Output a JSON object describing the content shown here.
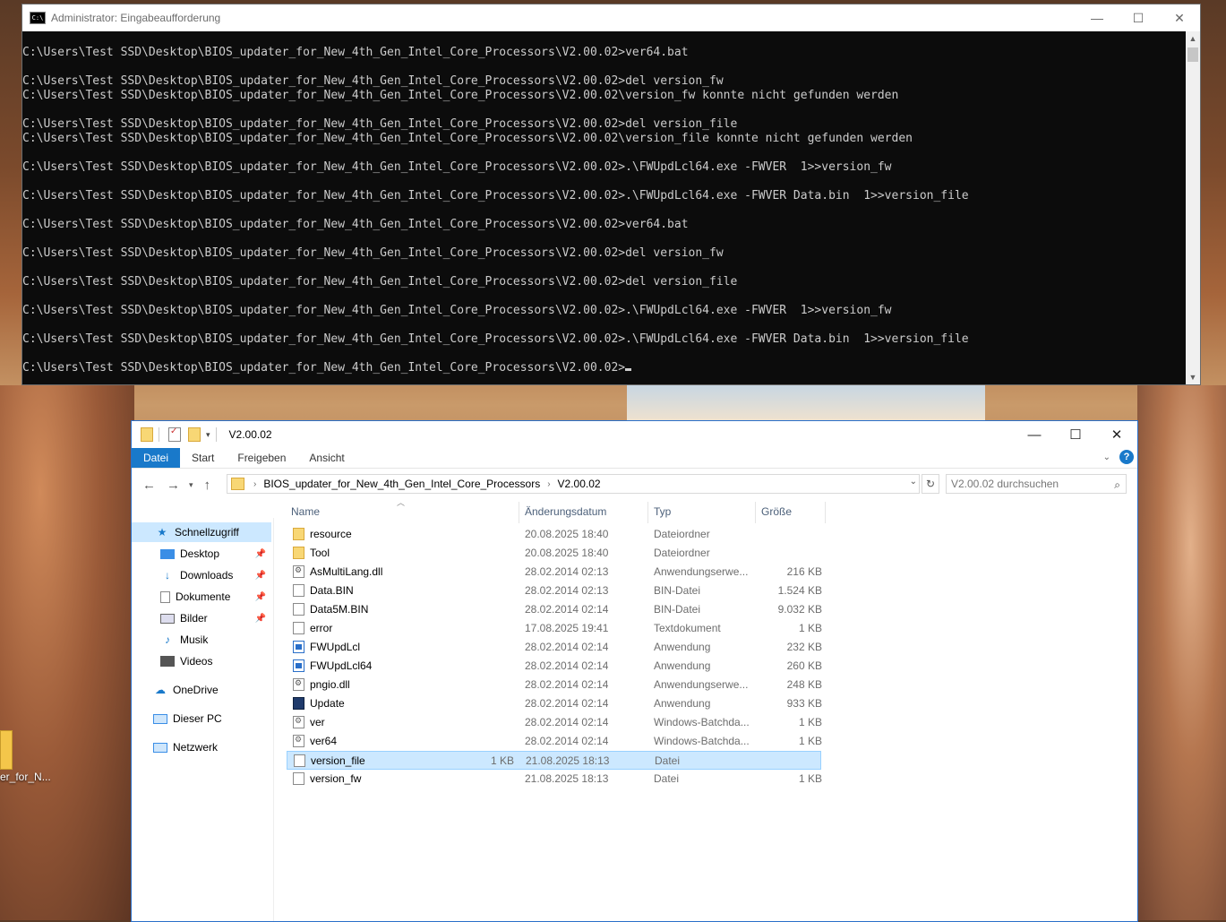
{
  "desktop": {
    "icon_label": "er_for_N..."
  },
  "cmd": {
    "icon": "C:\\",
    "title": "Administrator: Eingabeaufforderung",
    "lines": [
      "",
      "C:\\Users\\Test SSD\\Desktop\\BIOS_updater_for_New_4th_Gen_Intel_Core_Processors\\V2.00.02>ver64.bat",
      "",
      "C:\\Users\\Test SSD\\Desktop\\BIOS_updater_for_New_4th_Gen_Intel_Core_Processors\\V2.00.02>del version_fw",
      "C:\\Users\\Test SSD\\Desktop\\BIOS_updater_for_New_4th_Gen_Intel_Core_Processors\\V2.00.02\\version_fw konnte nicht gefunden werden",
      "",
      "C:\\Users\\Test SSD\\Desktop\\BIOS_updater_for_New_4th_Gen_Intel_Core_Processors\\V2.00.02>del version_file",
      "C:\\Users\\Test SSD\\Desktop\\BIOS_updater_for_New_4th_Gen_Intel_Core_Processors\\V2.00.02\\version_file konnte nicht gefunden werden",
      "",
      "C:\\Users\\Test SSD\\Desktop\\BIOS_updater_for_New_4th_Gen_Intel_Core_Processors\\V2.00.02>.\\FWUpdLcl64.exe -FWVER  1>>version_fw",
      "",
      "C:\\Users\\Test SSD\\Desktop\\BIOS_updater_for_New_4th_Gen_Intel_Core_Processors\\V2.00.02>.\\FWUpdLcl64.exe -FWVER Data.bin  1>>version_file",
      "",
      "C:\\Users\\Test SSD\\Desktop\\BIOS_updater_for_New_4th_Gen_Intel_Core_Processors\\V2.00.02>ver64.bat",
      "",
      "C:\\Users\\Test SSD\\Desktop\\BIOS_updater_for_New_4th_Gen_Intel_Core_Processors\\V2.00.02>del version_fw",
      "",
      "C:\\Users\\Test SSD\\Desktop\\BIOS_updater_for_New_4th_Gen_Intel_Core_Processors\\V2.00.02>del version_file",
      "",
      "C:\\Users\\Test SSD\\Desktop\\BIOS_updater_for_New_4th_Gen_Intel_Core_Processors\\V2.00.02>.\\FWUpdLcl64.exe -FWVER  1>>version_fw",
      "",
      "C:\\Users\\Test SSD\\Desktop\\BIOS_updater_for_New_4th_Gen_Intel_Core_Processors\\V2.00.02>.\\FWUpdLcl64.exe -FWVER Data.bin  1>>version_file",
      "",
      "C:\\Users\\Test SSD\\Desktop\\BIOS_updater_for_New_4th_Gen_Intel_Core_Processors\\V2.00.02>"
    ]
  },
  "explorer": {
    "title": "V2.00.02",
    "ribbon_tabs": [
      "Datei",
      "Start",
      "Freigeben",
      "Ansicht"
    ],
    "help": "?",
    "breadcrumb": [
      "BIOS_updater_for_New_4th_Gen_Intel_Core_Processors",
      "V2.00.02"
    ],
    "search_placeholder": "V2.00.02 durchsuchen",
    "nav": [
      {
        "label": "Schnellzugriff",
        "icon": "star-icon",
        "pinned": false,
        "selected": true
      },
      {
        "label": "Desktop",
        "icon": "desktop-icon",
        "pinned": true
      },
      {
        "label": "Downloads",
        "icon": "download-icon",
        "pinned": true
      },
      {
        "label": "Dokumente",
        "icon": "document-icon",
        "pinned": true
      },
      {
        "label": "Bilder",
        "icon": "picture-icon",
        "pinned": true
      },
      {
        "label": "Musik",
        "icon": "music-icon",
        "pinned": false
      },
      {
        "label": "Videos",
        "icon": "video-icon",
        "pinned": false
      },
      {
        "label": "OneDrive",
        "icon": "cloud-icon",
        "pinned": false
      },
      {
        "label": "Dieser PC",
        "icon": "computer-icon",
        "pinned": false
      },
      {
        "label": "Netzwerk",
        "icon": "network-icon",
        "pinned": false
      }
    ],
    "columns": [
      "Name",
      "Änderungsdatum",
      "Typ",
      "Größe"
    ],
    "files": [
      {
        "name": "resource",
        "date": "20.08.2025 18:40",
        "type": "Dateiordner",
        "size": "",
        "icon": "folder"
      },
      {
        "name": "Tool",
        "date": "20.08.2025 18:40",
        "type": "Dateiordner",
        "size": "",
        "icon": "folder"
      },
      {
        "name": "AsMultiLang.dll",
        "date": "28.02.2014 02:13",
        "type": "Anwendungserwe...",
        "size": "216 KB",
        "icon": "dll"
      },
      {
        "name": "Data.BIN",
        "date": "28.02.2014 02:13",
        "type": "BIN-Datei",
        "size": "1.524 KB",
        "icon": "file"
      },
      {
        "name": "Data5M.BIN",
        "date": "28.02.2014 02:14",
        "type": "BIN-Datei",
        "size": "9.032 KB",
        "icon": "file"
      },
      {
        "name": "error",
        "date": "17.08.2025 19:41",
        "type": "Textdokument",
        "size": "1 KB",
        "icon": "file"
      },
      {
        "name": "FWUpdLcl",
        "date": "28.02.2014 02:14",
        "type": "Anwendung",
        "size": "232 KB",
        "icon": "app"
      },
      {
        "name": "FWUpdLcl64",
        "date": "28.02.2014 02:14",
        "type": "Anwendung",
        "size": "260 KB",
        "icon": "app"
      },
      {
        "name": "pngio.dll",
        "date": "28.02.2014 02:14",
        "type": "Anwendungserwe...",
        "size": "248 KB",
        "icon": "dll"
      },
      {
        "name": "Update",
        "date": "28.02.2014 02:14",
        "type": "Anwendung",
        "size": "933 KB",
        "icon": "asus"
      },
      {
        "name": "ver",
        "date": "28.02.2014 02:14",
        "type": "Windows-Batchda...",
        "size": "1 KB",
        "icon": "bat"
      },
      {
        "name": "ver64",
        "date": "28.02.2014 02:14",
        "type": "Windows-Batchda...",
        "size": "1 KB",
        "icon": "bat"
      },
      {
        "name": "version_file",
        "date": "21.08.2025 18:13",
        "type": "Datei",
        "size": "1 KB",
        "icon": "file",
        "selected": true
      },
      {
        "name": "version_fw",
        "date": "21.08.2025 18:13",
        "type": "Datei",
        "size": "1 KB",
        "icon": "file"
      }
    ]
  }
}
